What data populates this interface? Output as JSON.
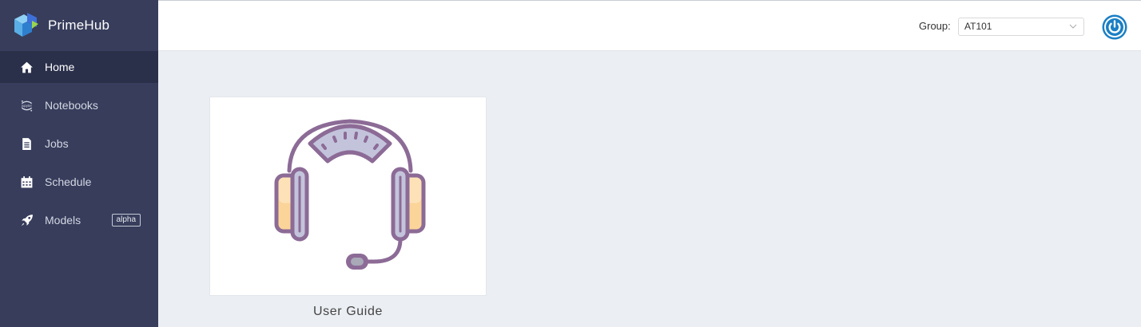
{
  "app": {
    "name": "PrimeHub"
  },
  "sidebar": {
    "items": [
      {
        "label": "Home",
        "icon": "home-icon",
        "active": true
      },
      {
        "label": "Notebooks",
        "icon": "jupyter-icon"
      },
      {
        "label": "Jobs",
        "icon": "jobs-icon"
      },
      {
        "label": "Schedule",
        "icon": "calendar-icon"
      },
      {
        "label": "Models",
        "icon": "rocket-icon",
        "badge": "alpha"
      }
    ]
  },
  "header": {
    "group_label": "Group:",
    "group_value": "AT101",
    "power_icon": "power-icon",
    "accent_color": "#1a7fc4"
  },
  "main": {
    "cards": [
      {
        "title": "User Guide",
        "icon": "headset-icon"
      }
    ]
  }
}
